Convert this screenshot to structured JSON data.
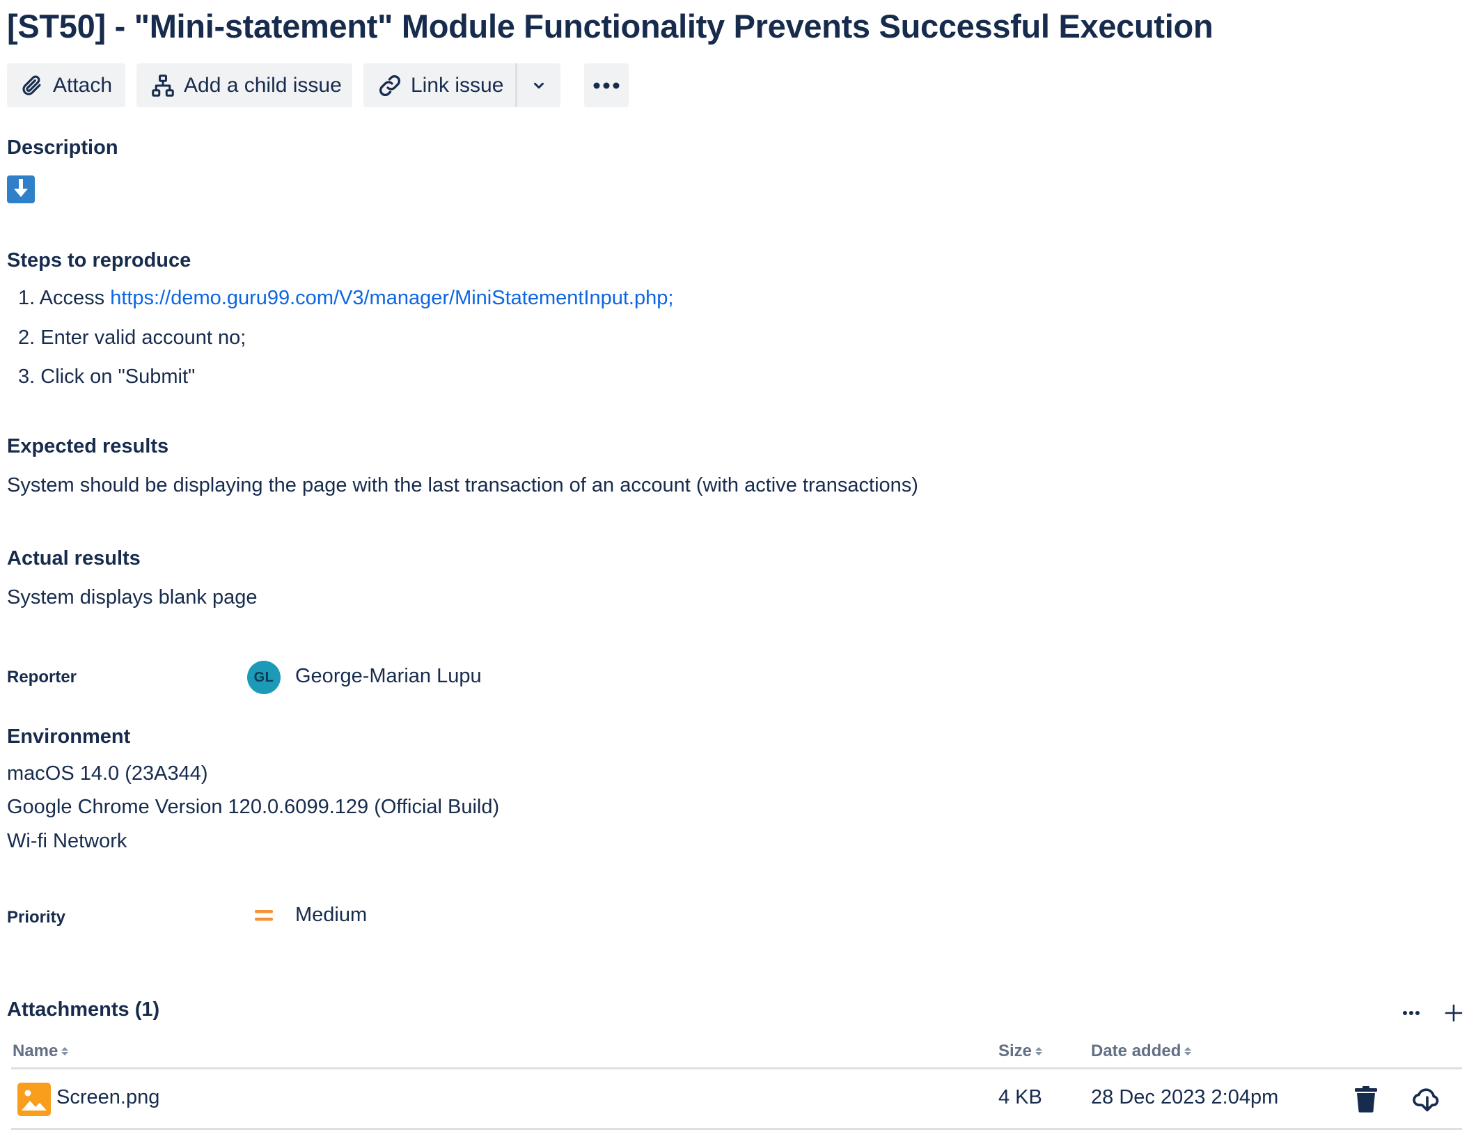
{
  "issue": {
    "title": "[ST50] - \"Mini-statement\" Module Functionality Prevents Successful Execution"
  },
  "toolbar": {
    "attach_label": "Attach",
    "child_issue_label": "Add a child issue",
    "link_issue_label": "Link issue"
  },
  "description": {
    "heading": "Description",
    "steps_heading": "Steps to reproduce",
    "steps": [
      {
        "num": "1.",
        "prefix": "Access ",
        "link": "https://demo.guru99.com/V3/manager/MiniStatementInput.php;"
      },
      {
        "num": "2.",
        "text": "Enter valid account no;"
      },
      {
        "num": "3.",
        "text": "Click on \"Submit\""
      }
    ],
    "expected_heading": "Expected results",
    "expected_text": "System should be displaying the page with the last transaction of an account (with active transactions)",
    "actual_heading": "Actual results",
    "actual_text": "System displays blank page"
  },
  "reporter": {
    "label": "Reporter",
    "initials": "GL",
    "name": "George-Marian Lupu",
    "avatar_color": "#1d9ab8"
  },
  "environment": {
    "heading": "Environment",
    "lines": [
      "macOS 14.0 (23A344)",
      "Google Chrome Version 120.0.6099.129 (Official Build)",
      "Wi-fi Network"
    ]
  },
  "priority": {
    "label": "Priority",
    "value": "Medium",
    "icon": "priority-medium-icon",
    "color": "#f79232"
  },
  "attachments": {
    "heading": "Attachments (1)",
    "columns": {
      "name": "Name",
      "size": "Size",
      "date": "Date added"
    },
    "files": [
      {
        "name": "Screen.png",
        "size": "4 KB",
        "date": "28 Dec 2023 2:04pm",
        "icon": "image-file-icon"
      }
    ]
  },
  "colors": {
    "text": "#172b4d",
    "link": "#0c66e4",
    "button_bg": "#f1f2f4",
    "subtle_text": "#626f86",
    "download_icon_bg": "#2f80c8",
    "image_icon_bg": "#f99d1c"
  }
}
